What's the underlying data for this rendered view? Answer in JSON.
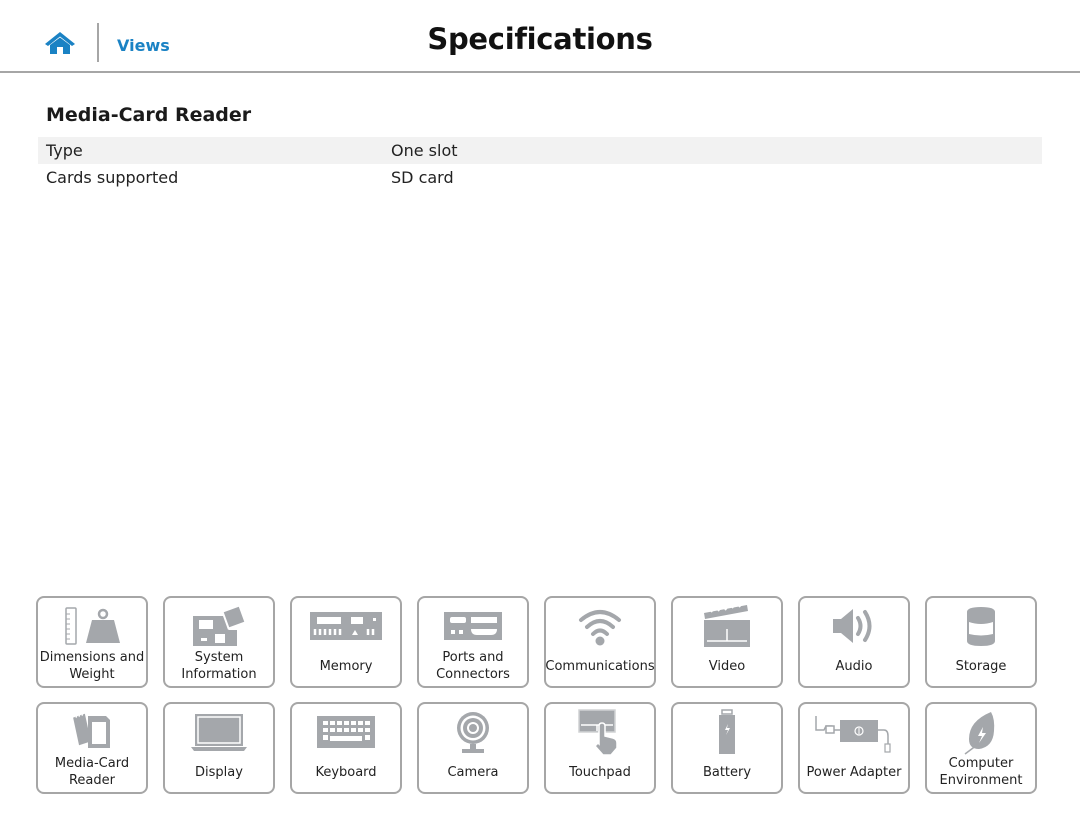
{
  "header": {
    "home_icon": "home-icon",
    "views_link": "Views",
    "title": "Specifications",
    "accent_color": "#1a82c4"
  },
  "section": {
    "title": "Media-Card Reader",
    "rows": [
      {
        "label": "Type",
        "value": "One slot"
      },
      {
        "label": "Cards supported",
        "value": "SD card"
      }
    ]
  },
  "tiles": [
    {
      "label": "Dimensions and Weight",
      "icon": "weight-ruler-icon"
    },
    {
      "label": "System Information",
      "icon": "motherboard-icon"
    },
    {
      "label": "Memory",
      "icon": "memory-module-icon"
    },
    {
      "label": "Ports and Connectors",
      "icon": "ports-icon"
    },
    {
      "label": "Communications",
      "icon": "wifi-icon"
    },
    {
      "label": "Video",
      "icon": "clapperboard-icon"
    },
    {
      "label": "Audio",
      "icon": "speaker-icon"
    },
    {
      "label": "Storage",
      "icon": "storage-drive-icon"
    },
    {
      "label": "Media-Card Reader",
      "icon": "sd-card-icon"
    },
    {
      "label": "Display",
      "icon": "laptop-display-icon"
    },
    {
      "label": "Keyboard",
      "icon": "keyboard-icon"
    },
    {
      "label": "Camera",
      "icon": "webcam-icon"
    },
    {
      "label": "Touchpad",
      "icon": "touchpad-icon"
    },
    {
      "label": "Battery",
      "icon": "battery-icon"
    },
    {
      "label": "Power Adapter",
      "icon": "power-adapter-icon"
    },
    {
      "label": "Computer Environment",
      "icon": "leaf-icon"
    }
  ]
}
